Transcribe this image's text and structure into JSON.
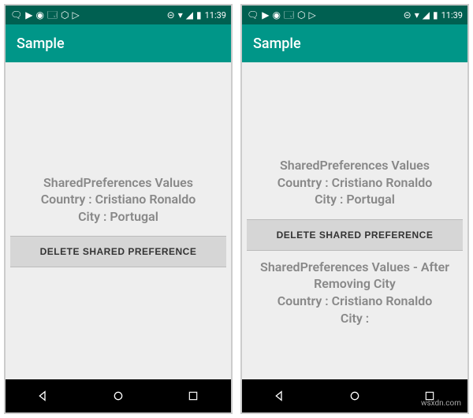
{
  "status": {
    "time": "11:39",
    "icons_left": [
      "🗨",
      "▶",
      "◉",
      "🗔",
      "⬡",
      "✈"
    ],
    "icons_right": [
      "⊝",
      "📶",
      "🔋"
    ]
  },
  "app": {
    "title": "Sample"
  },
  "left_screen": {
    "text_title": "SharedPreferences Values",
    "text_country": "Country : Cristiano Ronaldo",
    "text_city": "City : Portugal",
    "button_label": "DELETE SHARED PREFERENCE"
  },
  "right_screen": {
    "text_title": "SharedPreferences Values",
    "text_country": "Country : Cristiano Ronaldo",
    "text_city": "City : Portugal",
    "button_label": "DELETE SHARED PREFERENCE",
    "after_title": "SharedPreferences Values - After Removing City",
    "after_country": "Country : Cristiano Ronaldo",
    "after_city": "City :"
  },
  "watermark": "wsxdn.com"
}
